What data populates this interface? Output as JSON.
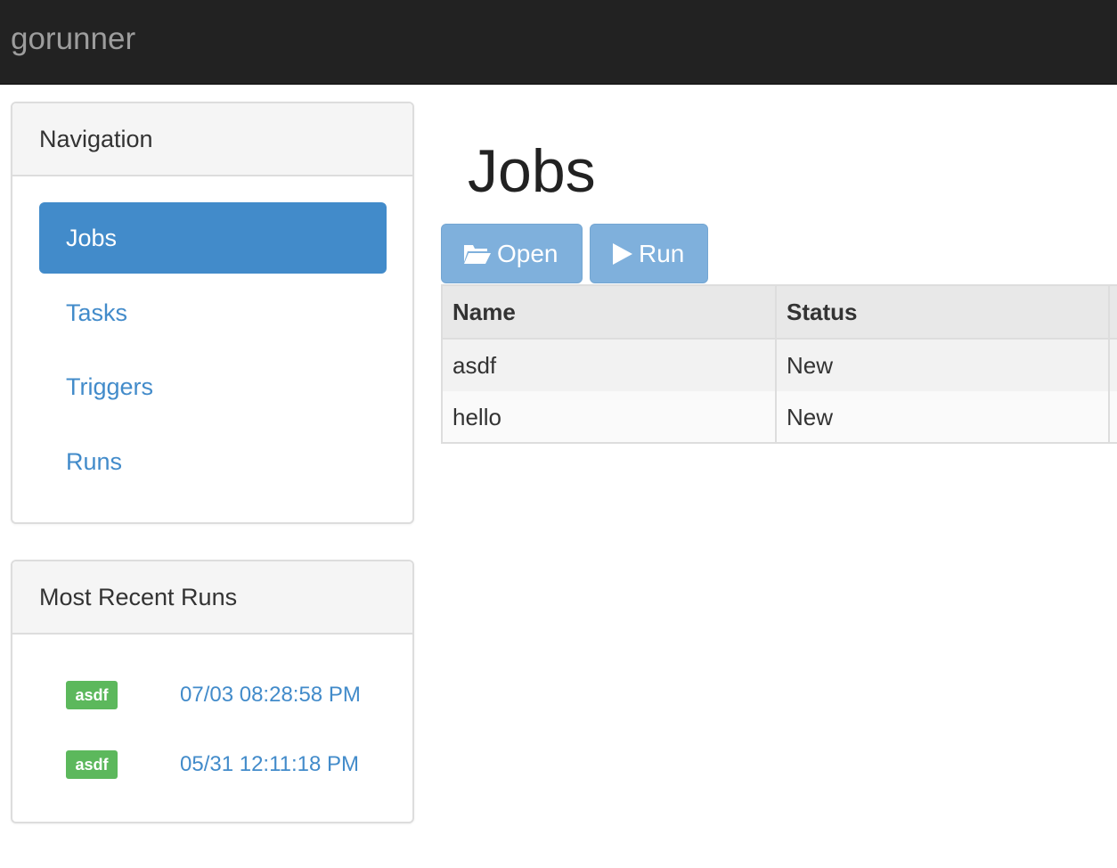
{
  "app": {
    "brand": "gorunner"
  },
  "sidebar": {
    "navigation": {
      "title": "Navigation",
      "items": [
        {
          "label": "Jobs",
          "active": true
        },
        {
          "label": "Tasks",
          "active": false
        },
        {
          "label": "Triggers",
          "active": false
        },
        {
          "label": "Runs",
          "active": false
        }
      ]
    },
    "recent_runs": {
      "title": "Most Recent Runs",
      "items": [
        {
          "job": "asdf",
          "time": "07/03 08:28:58 PM"
        },
        {
          "job": "asdf",
          "time": "05/31 12:11:18 PM"
        }
      ]
    }
  },
  "main": {
    "title": "Jobs",
    "toolbar": {
      "open_label": "Open",
      "open_icon": "folder-open-icon",
      "run_label": "Run",
      "run_icon": "play-icon"
    },
    "table": {
      "columns": [
        "Name",
        "Status"
      ],
      "rows": [
        {
          "name": "asdf",
          "status": "New"
        },
        {
          "name": "hello",
          "status": "New"
        }
      ]
    }
  },
  "colors": {
    "navbar": "#222222",
    "primary": "#428bca",
    "button_disabled": "#7fb0dc",
    "badge_success": "#5cb85c"
  }
}
